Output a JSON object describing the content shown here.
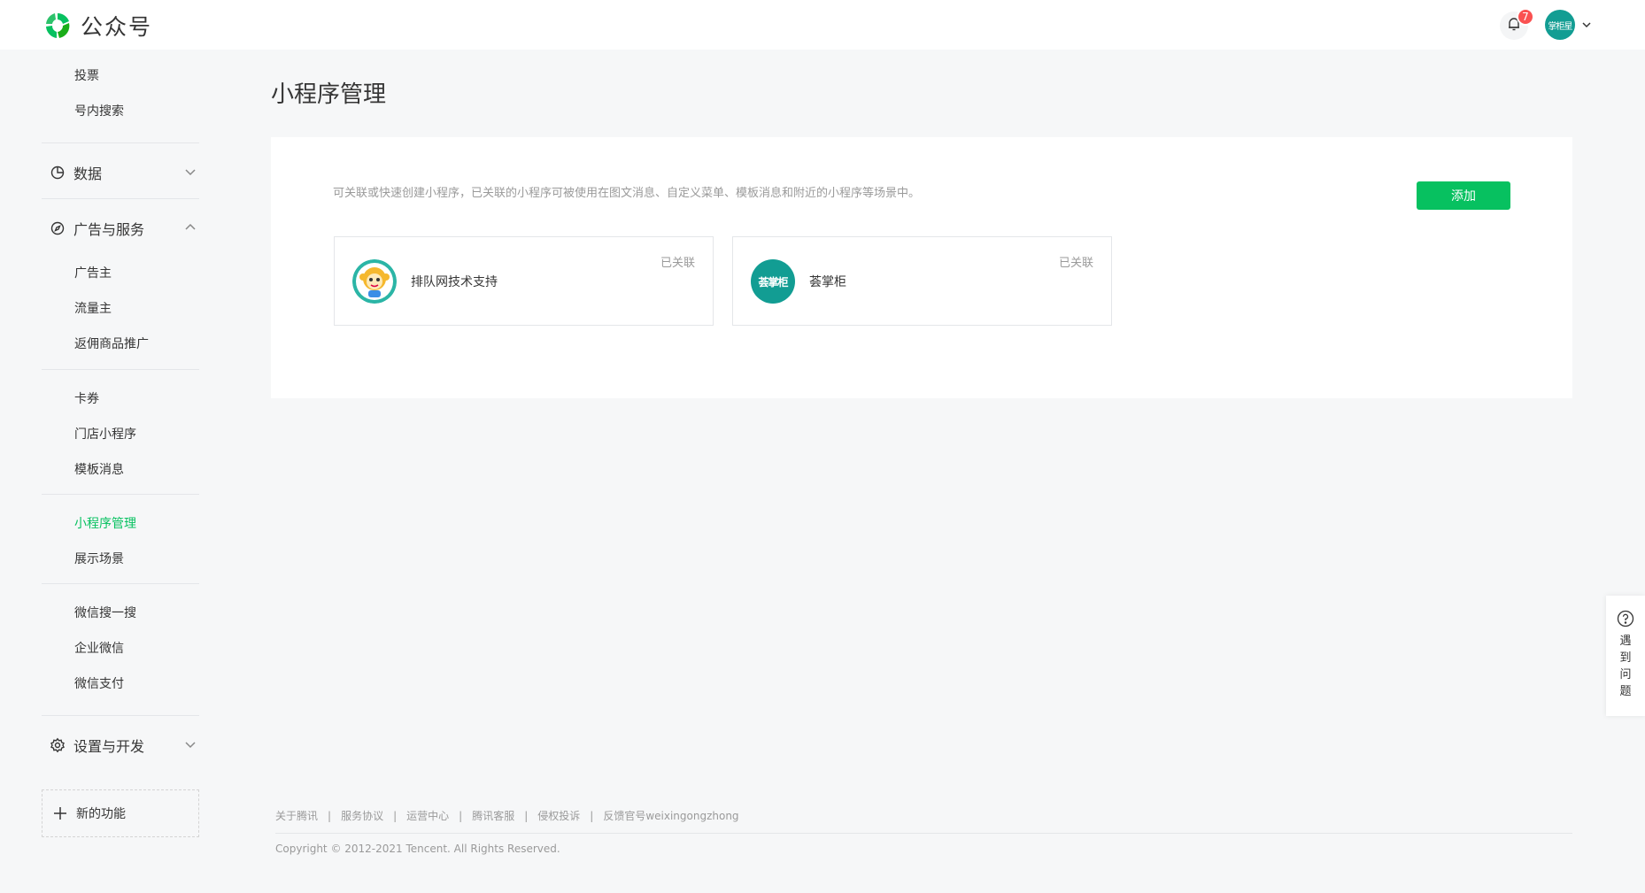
{
  "header": {
    "app_title": "公众号",
    "notification_count": "7",
    "account_avatar_text": "掌柜星"
  },
  "sidebar": {
    "top_items": [
      "投票",
      "号内搜索"
    ],
    "data_group": "数据",
    "ads_group": "广告与服务",
    "ads_items": [
      "广告主",
      "流量主",
      "返佣商品推广"
    ],
    "service_items": [
      "卡券",
      "门店小程序",
      "模板消息"
    ],
    "miniprogram_items": [
      "小程序管理",
      "展示场景"
    ],
    "wechat_items": [
      "微信搜一搜",
      "企业微信",
      "微信支付"
    ],
    "settings_group": "设置与开发",
    "new_features": "新的功能"
  },
  "main": {
    "page_title": "小程序管理",
    "description": "可关联或快速创建小程序，已关联的小程序可被使用在图文消息、自定义菜单、模板消息和附近的小程序等场景中。",
    "add_button": "添加",
    "cards": [
      {
        "name": "排队网技术支持",
        "status": "已关联"
      },
      {
        "name": "荟掌柜",
        "status": "已关联",
        "avatar_text": "荟掌柜"
      }
    ]
  },
  "footer": {
    "links": [
      "关于腾讯",
      "服务协议",
      "运营中心",
      "腾讯客服",
      "侵权投诉",
      "反馈官号weixingongzhong"
    ],
    "separator": "|",
    "copyright": "Copyright © 2012-2021 Tencent. All Rights Reserved."
  },
  "help": {
    "label": "遇到问题"
  },
  "colors": {
    "accent": "#07c160",
    "badge": "#fa5151",
    "avatar_teal": "#129d93"
  }
}
